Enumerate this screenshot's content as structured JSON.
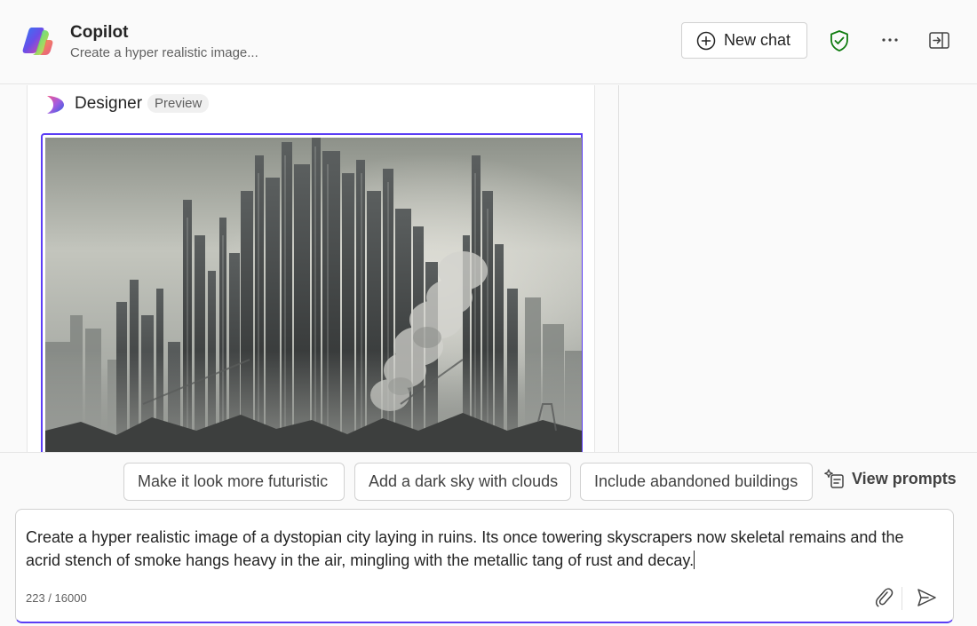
{
  "header": {
    "title": "Copilot",
    "subtitle": "Create a hyper realistic image...",
    "new_chat_label": "New chat",
    "icons": [
      "copilot-logo",
      "plus-circle-icon",
      "shield-check-icon",
      "more-icon",
      "panel-toggle-icon"
    ]
  },
  "designer": {
    "title": "Designer",
    "badge": "Preview",
    "icon": "designer-logo"
  },
  "suggestions": [
    "Make it look more futuristic",
    "Add a dark sky with clouds",
    "Include abandoned buildings"
  ],
  "view_prompts_label": "View prompts",
  "composer": {
    "text": "Create a hyper realistic image of a dystopian city laying in ruins. Its once towering skyscrapers now skeletal remains and the acrid stench of smoke hangs heavy in the air, mingling with the metallic tang of rust and decay.",
    "char_count": "223 / 16000"
  },
  "colors": {
    "accent": "#5b3df5",
    "shield_green": "#107c10"
  }
}
